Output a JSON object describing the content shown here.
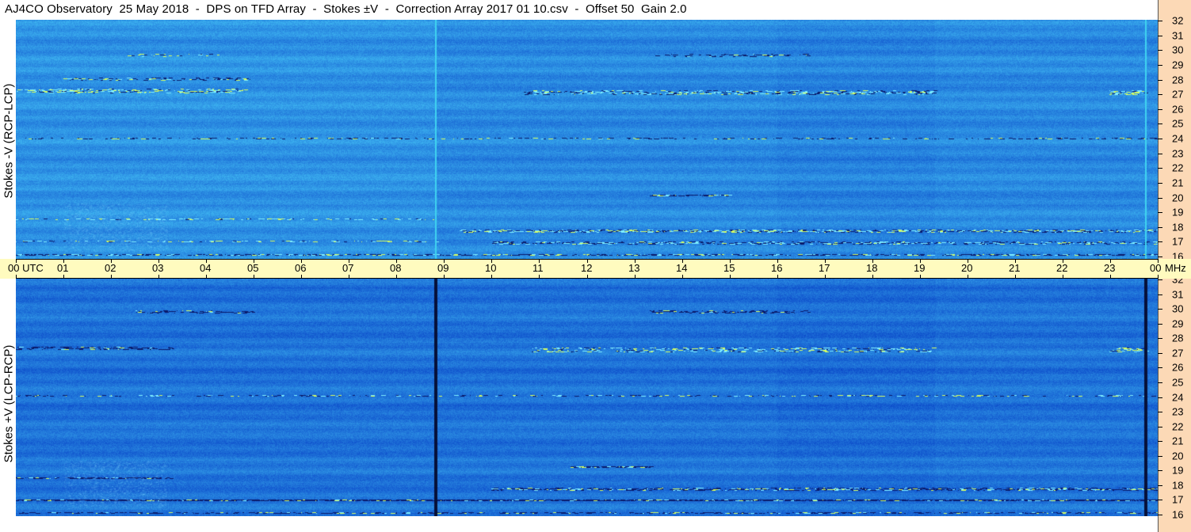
{
  "title": "AJ4CO Observatory  25 May 2018  -  DPS on TFD Array  -  Stokes ±V  -  Correction Array 2017 01 10.csv  -  Offset 50  Gain 2.0",
  "panels": {
    "top": {
      "ylabel": "Stokes -V (RCP-LCP)"
    },
    "bottom": {
      "ylabel": "Stokes +V (LCP-RCP)"
    }
  },
  "time_axis": {
    "labels": [
      "00 UTC",
      "01",
      "02",
      "03",
      "04",
      "05",
      "06",
      "07",
      "08",
      "09",
      "10",
      "11",
      "12",
      "13",
      "14",
      "15",
      "16",
      "17",
      "18",
      "19",
      "20",
      "21",
      "22",
      "23",
      "00"
    ]
  },
  "freq_axis": {
    "unit": "MHz",
    "labels": [
      "32",
      "31",
      "30",
      "29",
      "28",
      "27",
      "26",
      "25",
      "24",
      "23",
      "22",
      "21",
      "20",
      "19",
      "18",
      "17",
      "16"
    ],
    "bottom_label": "16 MHz"
  },
  "colors": {
    "spectrogram_base": "#1e6fe0",
    "freq_scale_bg": "#fcd9b6",
    "time_axis_bg": "#fffbbf"
  }
}
